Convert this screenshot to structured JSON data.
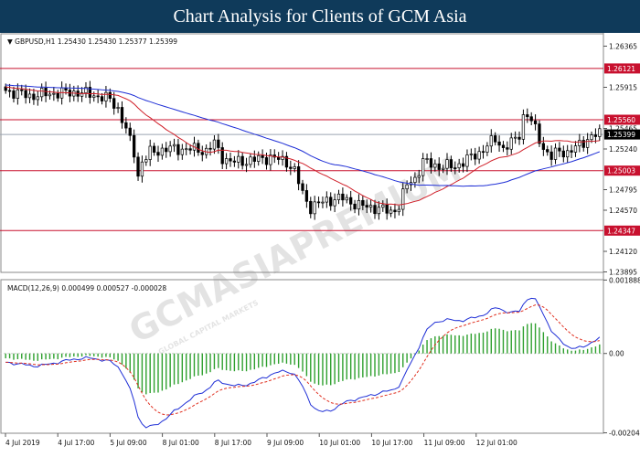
{
  "header": {
    "title": "Chart Analysis for Clients of GCM Asia"
  },
  "chart_data": {
    "type": "candlestick",
    "symbol_label": "GBPUSD,H1",
    "ohlc_label": "1.25430 1.25430 1.25377 1.25399",
    "price_ticks": [
      "1.26365",
      "1.25915",
      "1.25465",
      "1.25240",
      "1.24795",
      "1.24570",
      "1.24120",
      "1.23895"
    ],
    "levels": [
      {
        "label": "1.26121",
        "value": 1.26121
      },
      {
        "label": "1.25560",
        "value": 1.2556
      },
      {
        "label": "1.25003",
        "value": 1.25003
      },
      {
        "label": "1.24347",
        "value": 1.24347
      }
    ],
    "current_price": {
      "label": "1.25399",
      "value": 1.25399
    },
    "macd": {
      "label": "MACD(12,26,9) 0.000499 0.000527 -0.000028",
      "ticks": [
        "0.001888",
        "0.00",
        "-0.002041"
      ],
      "zero_label": "0.00"
    },
    "time_labels": [
      "4 Jul 2019",
      "4 Jul 17:00",
      "5 Jul 09:00",
      "8 Jul 01:00",
      "8 Jul 17:00",
      "9 Jul 09:00",
      "10 Jul 01:00",
      "10 Jul 17:00",
      "11 Jul 09:00",
      "12 Jul 01:00"
    ],
    "close_anchors": [
      [
        0,
        1.2588
      ],
      [
        6,
        1.2582
      ],
      [
        12,
        1.2585
      ],
      [
        18,
        1.2586
      ],
      [
        22,
        1.2583
      ],
      [
        26,
        1.2578
      ],
      [
        28,
        1.2568
      ],
      [
        30,
        1.2545
      ],
      [
        32,
        1.252
      ],
      [
        33,
        1.2495
      ],
      [
        34,
        1.251
      ],
      [
        36,
        1.252
      ],
      [
        40,
        1.2524
      ],
      [
        46,
        1.2524
      ],
      [
        50,
        1.2522
      ],
      [
        52,
        1.253
      ],
      [
        54,
        1.2515
      ],
      [
        56,
        1.251
      ],
      [
        58,
        1.251
      ],
      [
        62,
        1.2512
      ],
      [
        66,
        1.2515
      ],
      [
        70,
        1.251
      ],
      [
        72,
        1.25
      ],
      [
        74,
        1.2475
      ],
      [
        76,
        1.246
      ],
      [
        80,
        1.2468
      ],
      [
        84,
        1.247
      ],
      [
        88,
        1.2462
      ],
      [
        92,
        1.246
      ],
      [
        96,
        1.2455
      ],
      [
        98,
        1.2462
      ],
      [
        100,
        1.2485
      ],
      [
        102,
        1.2492
      ],
      [
        104,
        1.251
      ],
      [
        108,
        1.2505
      ],
      [
        112,
        1.2505
      ],
      [
        116,
        1.2515
      ],
      [
        118,
        1.252
      ],
      [
        122,
        1.2535
      ],
      [
        124,
        1.2525
      ],
      [
        126,
        1.253
      ],
      [
        128,
        1.254
      ],
      [
        129,
        1.256
      ],
      [
        130,
        1.2562
      ],
      [
        132,
        1.2545
      ],
      [
        134,
        1.2525
      ],
      [
        136,
        1.2515
      ],
      [
        138,
        1.2522
      ],
      [
        140,
        1.252
      ],
      [
        142,
        1.2525
      ],
      [
        144,
        1.2532
      ],
      [
        146,
        1.2538
      ],
      [
        148,
        1.254
      ]
    ],
    "colors": {
      "level": "#c8102e",
      "current": "#000000",
      "ma_fast": "#d0202a",
      "ma_slow": "#1f2fd6",
      "macd_hist": "#2ea02e",
      "macd_line": "#1f2fd6",
      "macd_signal": "#e03020",
      "text": "#111111"
    },
    "ylim": [
      1.2389,
      1.2651
    ],
    "macd_ylim": [
      -0.002041,
      0.001888
    ],
    "watermark": {
      "text": "GCMASIAPREMIUM",
      "sub": "GLOBAL CAPITAL MARKETS"
    }
  }
}
